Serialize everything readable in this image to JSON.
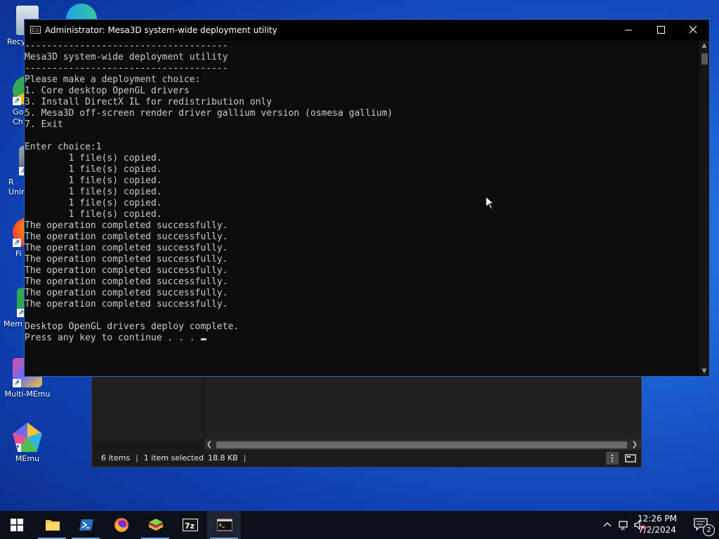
{
  "desktop": {
    "icons": [
      {
        "label": "Recy"
      },
      {
        "label": "Go\nCh"
      },
      {
        "label": "R\nUnin"
      },
      {
        "label": "Fi"
      },
      {
        "label": "Mem"
      },
      {
        "label": "Multi-MEmu"
      },
      {
        "label": "MEmu"
      }
    ]
  },
  "cmd_window": {
    "title": "Administrator:  Mesa3D system-wide deployment utility",
    "icon_text": "C:\\",
    "lines": [
      "-------------------------------------",
      "Mesa3D system-wide deployment utility",
      "-------------------------------------",
      "Please make a deployment choice:",
      "1. Core desktop OpenGL drivers",
      "3. Install DirectX IL for redistribution only",
      "5. Mesa3D off-screen render driver gallium version (osmesa gallium)",
      "7. Exit",
      "",
      "Enter choice:1",
      "        1 file(s) copied.",
      "        1 file(s) copied.",
      "        1 file(s) copied.",
      "        1 file(s) copied.",
      "        1 file(s) copied.",
      "        1 file(s) copied.",
      "The operation completed successfully.",
      "The operation completed successfully.",
      "The operation completed successfully.",
      "The operation completed successfully.",
      "The operation completed successfully.",
      "The operation completed successfully.",
      "The operation completed successfully.",
      "The operation completed successfully.",
      "",
      "Desktop OpenGL drivers deploy complete.",
      "Press any key to continue . . . "
    ]
  },
  "explorer": {
    "status_items_count": "6 items",
    "status_selected": "1 item selected",
    "status_size": "18.8 KB"
  },
  "taskbar": {
    "apps": [
      "start-button",
      "file-explorer",
      "powershell",
      "firefox",
      "bluestacks",
      "7-zip",
      "command-prompt"
    ],
    "time": "12:26 PM",
    "date": "7/2/2024",
    "notification_count": "2"
  },
  "colors": {
    "console_bg": "#0c0c0c",
    "console_text": "#cccccc",
    "taskbar_bg": "#0b0f17",
    "accent": "#2a6ad1"
  }
}
